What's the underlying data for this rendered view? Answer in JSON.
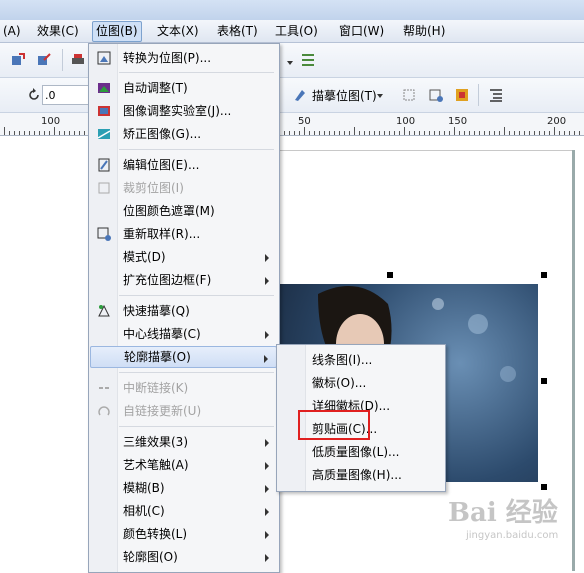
{
  "menubar": {
    "items": [
      "(A)",
      "效果(C)",
      "位图(B)",
      "文本(X)",
      "表格(T)",
      "工具(O)",
      "窗口(W)",
      "帮助(H)"
    ]
  },
  "toolbar2": {
    "rotation_value": ".0",
    "trace_bitmap_label": "描摹位图(T)"
  },
  "ruler": {
    "labels": [
      "100",
      "50",
      "100",
      "150",
      "200"
    ]
  },
  "bitmap_menu": {
    "items": [
      {
        "label": "转换为位图(P)...",
        "icon": "convert-to-bitmap-icon",
        "enabled": true,
        "submenu": false
      },
      {
        "label": "自动调整(T)",
        "icon": "auto-adjust-icon",
        "enabled": true,
        "submenu": false
      },
      {
        "label": "图像调整实验室(J)...",
        "icon": "image-adjust-lab-icon",
        "enabled": true,
        "submenu": false
      },
      {
        "label": "矫正图像(G)...",
        "icon": "straighten-image-icon",
        "enabled": true,
        "submenu": false
      },
      {
        "label": "编辑位图(E)...",
        "icon": "edit-bitmap-icon",
        "enabled": true,
        "submenu": false
      },
      {
        "label": "裁剪位图(I)",
        "icon": "crop-bitmap-icon",
        "enabled": false,
        "submenu": false
      },
      {
        "label": "位图颜色遮罩(M)",
        "icon": "",
        "enabled": true,
        "submenu": false
      },
      {
        "label": "重新取样(R)...",
        "icon": "resample-icon",
        "enabled": true,
        "submenu": false
      },
      {
        "label": "模式(D)",
        "icon": "",
        "enabled": true,
        "submenu": true
      },
      {
        "label": "扩充位图边框(F)",
        "icon": "",
        "enabled": true,
        "submenu": true
      },
      {
        "label": "快速描摹(Q)",
        "icon": "quick-trace-icon",
        "enabled": true,
        "submenu": false
      },
      {
        "label": "中心线描摹(C)",
        "icon": "",
        "enabled": true,
        "submenu": true
      },
      {
        "label": "轮廓描摹(O)",
        "icon": "",
        "enabled": true,
        "submenu": true
      },
      {
        "label": "中断链接(K)",
        "icon": "break-link-icon",
        "enabled": false,
        "submenu": false
      },
      {
        "label": "自链接更新(U)",
        "icon": "update-link-icon",
        "enabled": false,
        "submenu": false
      },
      {
        "label": "三维效果(3)",
        "icon": "",
        "enabled": true,
        "submenu": true
      },
      {
        "label": "艺术笔触(A)",
        "icon": "",
        "enabled": true,
        "submenu": true
      },
      {
        "label": "模糊(B)",
        "icon": "",
        "enabled": true,
        "submenu": true
      },
      {
        "label": "相机(C)",
        "icon": "",
        "enabled": true,
        "submenu": true
      },
      {
        "label": "颜色转换(L)",
        "icon": "",
        "enabled": true,
        "submenu": true
      },
      {
        "label": "轮廓图(O)",
        "icon": "",
        "enabled": true,
        "submenu": true
      }
    ]
  },
  "outline_trace_submenu": {
    "items": [
      "线条图(I)...",
      "徽标(O)...",
      "详细徽标(D)...",
      "剪贴画(C)...",
      "低质量图像(L)...",
      "高质量图像(H)..."
    ]
  },
  "watermark": {
    "text": "Bai 经验",
    "sub": "jingyan.baidu.com"
  },
  "colors": {
    "highlight_border": "#9bb7e0",
    "red_box": "#e02020"
  }
}
